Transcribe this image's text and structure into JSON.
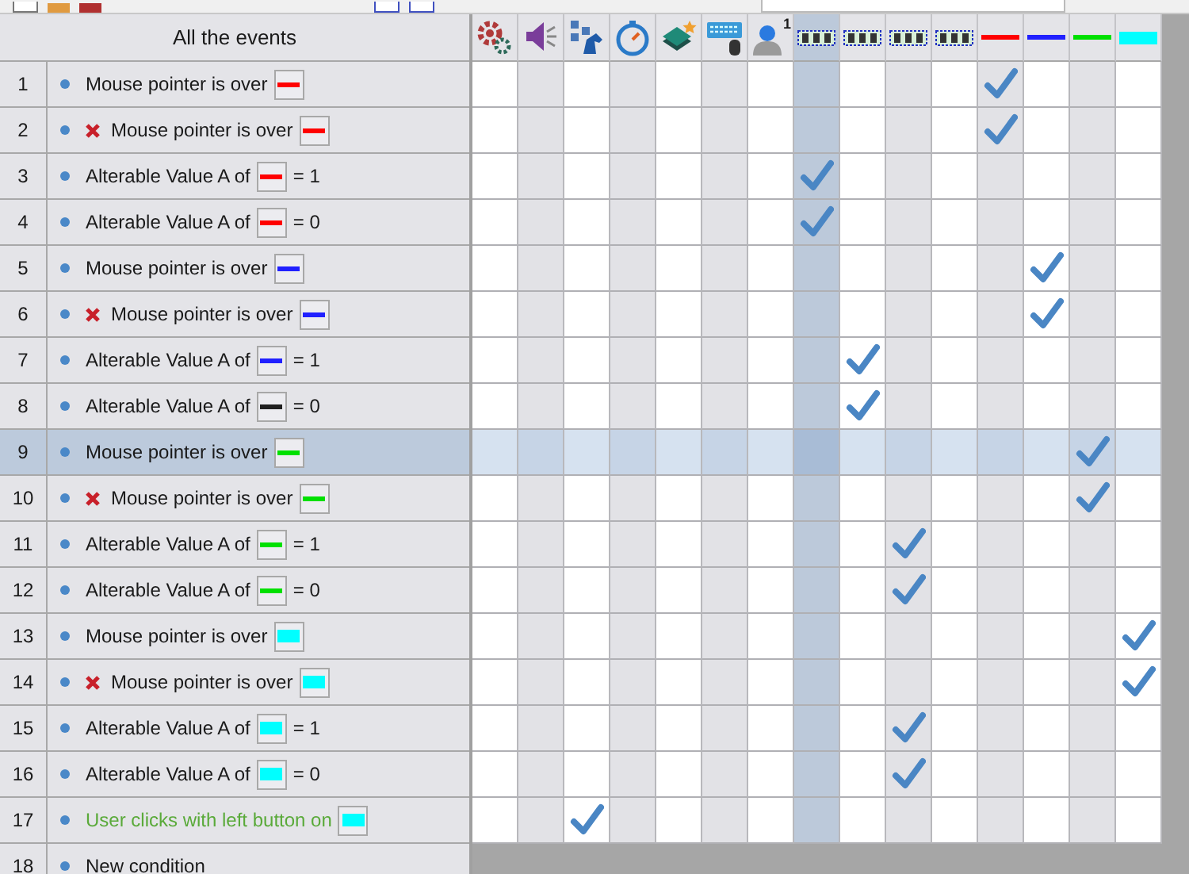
{
  "events_header": "All the events",
  "columns": [
    {
      "kind": "system",
      "selected": false
    },
    {
      "kind": "sound",
      "selected": false
    },
    {
      "kind": "storyboard",
      "selected": false
    },
    {
      "kind": "timer",
      "selected": false
    },
    {
      "kind": "layers",
      "selected": false
    },
    {
      "kind": "keyboard",
      "selected": false
    },
    {
      "kind": "player",
      "badge": "1",
      "selected": false
    },
    {
      "kind": "string",
      "selected": true
    },
    {
      "kind": "string",
      "selected": false
    },
    {
      "kind": "string",
      "selected": false
    },
    {
      "kind": "string",
      "selected": false
    },
    {
      "kind": "line",
      "color": "#ff0000",
      "selected": false
    },
    {
      "kind": "line",
      "color": "#2020ff",
      "selected": false
    },
    {
      "kind": "line",
      "color": "#00e000",
      "selected": false
    },
    {
      "kind": "bar",
      "color": "#00ffff",
      "selected": false
    }
  ],
  "rows": [
    {
      "number": "1",
      "negated": false,
      "trigger": false,
      "selected": false,
      "text": "Mouse pointer is over",
      "object": {
        "kind": "line",
        "color": "#ff0000"
      },
      "cells": [
        false,
        false,
        false,
        false,
        false,
        false,
        false,
        false,
        false,
        false,
        false,
        true,
        false,
        false,
        false
      ]
    },
    {
      "number": "2",
      "negated": true,
      "trigger": false,
      "selected": false,
      "text": "Mouse pointer is over",
      "object": {
        "kind": "line",
        "color": "#ff0000"
      },
      "cells": [
        false,
        false,
        false,
        false,
        false,
        false,
        false,
        false,
        false,
        false,
        false,
        true,
        false,
        false,
        false
      ]
    },
    {
      "number": "3",
      "negated": false,
      "trigger": false,
      "selected": false,
      "text": "Alterable Value A of",
      "object": {
        "kind": "line",
        "color": "#ff0000"
      },
      "suffix": "= 1",
      "cells": [
        false,
        false,
        false,
        false,
        false,
        false,
        false,
        true,
        false,
        false,
        false,
        false,
        false,
        false,
        false
      ]
    },
    {
      "number": "4",
      "negated": false,
      "trigger": false,
      "selected": false,
      "text": "Alterable Value A of",
      "object": {
        "kind": "line",
        "color": "#ff0000"
      },
      "suffix": "= 0",
      "cells": [
        false,
        false,
        false,
        false,
        false,
        false,
        false,
        true,
        false,
        false,
        false,
        false,
        false,
        false,
        false
      ]
    },
    {
      "number": "5",
      "negated": false,
      "trigger": false,
      "selected": false,
      "text": "Mouse pointer is over",
      "object": {
        "kind": "line",
        "color": "#2020ff"
      },
      "cells": [
        false,
        false,
        false,
        false,
        false,
        false,
        false,
        false,
        false,
        false,
        false,
        false,
        true,
        false,
        false
      ]
    },
    {
      "number": "6",
      "negated": true,
      "trigger": false,
      "selected": false,
      "text": "Mouse pointer is over",
      "object": {
        "kind": "line",
        "color": "#2020ff"
      },
      "cells": [
        false,
        false,
        false,
        false,
        false,
        false,
        false,
        false,
        false,
        false,
        false,
        false,
        true,
        false,
        false
      ]
    },
    {
      "number": "7",
      "negated": false,
      "trigger": false,
      "selected": false,
      "text": "Alterable Value A of",
      "object": {
        "kind": "line",
        "color": "#2020ff"
      },
      "suffix": "= 1",
      "cells": [
        false,
        false,
        false,
        false,
        false,
        false,
        false,
        false,
        true,
        false,
        false,
        false,
        false,
        false,
        false
      ]
    },
    {
      "number": "8",
      "negated": false,
      "trigger": false,
      "selected": false,
      "text": "Alterable Value A of",
      "object": {
        "kind": "line",
        "color": "#202020"
      },
      "suffix": "= 0",
      "cells": [
        false,
        false,
        false,
        false,
        false,
        false,
        false,
        false,
        true,
        false,
        false,
        false,
        false,
        false,
        false
      ]
    },
    {
      "number": "9",
      "negated": false,
      "trigger": false,
      "selected": true,
      "text": "Mouse pointer is over",
      "object": {
        "kind": "line",
        "color": "#00e000"
      },
      "cells": [
        false,
        false,
        false,
        false,
        false,
        false,
        false,
        false,
        false,
        false,
        false,
        false,
        false,
        true,
        false
      ]
    },
    {
      "number": "10",
      "negated": true,
      "trigger": false,
      "selected": false,
      "text": "Mouse pointer is over",
      "object": {
        "kind": "line",
        "color": "#00e000"
      },
      "cells": [
        false,
        false,
        false,
        false,
        false,
        false,
        false,
        false,
        false,
        false,
        false,
        false,
        false,
        true,
        false
      ]
    },
    {
      "number": "11",
      "negated": false,
      "trigger": false,
      "selected": false,
      "text": "Alterable Value A of",
      "object": {
        "kind": "line",
        "color": "#00e000"
      },
      "suffix": "= 1",
      "cells": [
        false,
        false,
        false,
        false,
        false,
        false,
        false,
        false,
        false,
        true,
        false,
        false,
        false,
        false,
        false
      ]
    },
    {
      "number": "12",
      "negated": false,
      "trigger": false,
      "selected": false,
      "text": "Alterable Value A of",
      "object": {
        "kind": "line",
        "color": "#00e000"
      },
      "suffix": "= 0",
      "cells": [
        false,
        false,
        false,
        false,
        false,
        false,
        false,
        false,
        false,
        true,
        false,
        false,
        false,
        false,
        false
      ]
    },
    {
      "number": "13",
      "negated": false,
      "trigger": false,
      "selected": false,
      "text": "Mouse pointer is over",
      "object": {
        "kind": "bar",
        "color": "#00ffff"
      },
      "cells": [
        false,
        false,
        false,
        false,
        false,
        false,
        false,
        false,
        false,
        false,
        false,
        false,
        false,
        false,
        true
      ]
    },
    {
      "number": "14",
      "negated": true,
      "trigger": false,
      "selected": false,
      "text": "Mouse pointer is over",
      "object": {
        "kind": "bar",
        "color": "#00ffff"
      },
      "cells": [
        false,
        false,
        false,
        false,
        false,
        false,
        false,
        false,
        false,
        false,
        false,
        false,
        false,
        false,
        true
      ]
    },
    {
      "number": "15",
      "negated": false,
      "trigger": false,
      "selected": false,
      "text": "Alterable Value A of",
      "object": {
        "kind": "bar",
        "color": "#00ffff"
      },
      "suffix": "= 1",
      "cells": [
        false,
        false,
        false,
        false,
        false,
        false,
        false,
        false,
        false,
        true,
        false,
        false,
        false,
        false,
        false
      ]
    },
    {
      "number": "16",
      "negated": false,
      "trigger": false,
      "selected": false,
      "text": "Alterable Value A of",
      "object": {
        "kind": "bar",
        "color": "#00ffff"
      },
      "suffix": "= 0",
      "cells": [
        false,
        false,
        false,
        false,
        false,
        false,
        false,
        false,
        false,
        true,
        false,
        false,
        false,
        false,
        false
      ]
    },
    {
      "number": "17",
      "negated": false,
      "trigger": true,
      "selected": false,
      "text": "User clicks with left button on",
      "object": {
        "kind": "bar",
        "color": "#00ffff"
      },
      "cells": [
        false,
        false,
        true,
        false,
        false,
        false,
        false,
        false,
        false,
        false,
        false,
        false,
        false,
        false,
        false
      ]
    },
    {
      "number": "18",
      "negated": false,
      "trigger": false,
      "selected": false,
      "text": "New condition"
    }
  ]
}
